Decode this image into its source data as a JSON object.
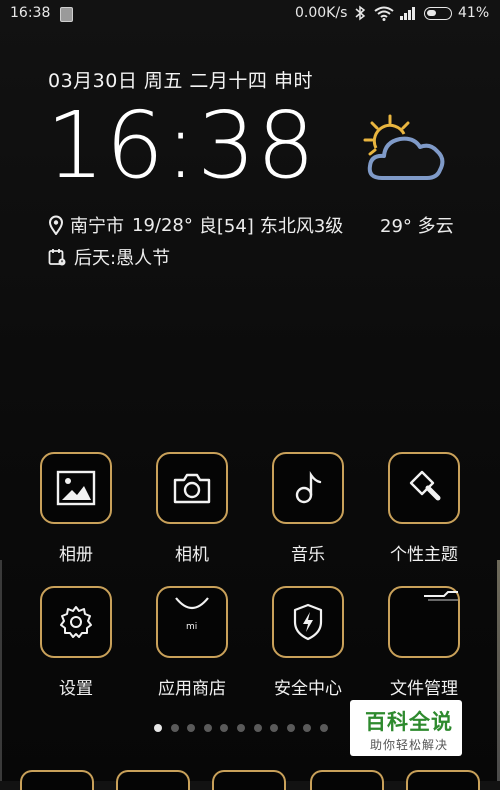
{
  "status_bar": {
    "time": "16:38",
    "net_speed": "0.00K/s",
    "battery_percent": "41%",
    "battery_level": 0.41,
    "icons": [
      "notification-icon",
      "bluetooth-icon",
      "wifi-icon",
      "signal-icon",
      "battery-icon"
    ]
  },
  "lockscreen": {
    "date": "03月30日  周五  二月十四  申时",
    "clock": "16:38",
    "location": {
      "city": "南宁市",
      "temp_range": "19/28°",
      "aqi": "良[54]",
      "wind": "东北风3级"
    },
    "current_weather": "29°  多云",
    "holiday": "后天:愚人节",
    "weather_icon": "partly-cloudy-icon"
  },
  "apps": [
    {
      "label": "相册",
      "icon": "gallery-icon"
    },
    {
      "label": "相机",
      "icon": "camera-icon"
    },
    {
      "label": "音乐",
      "icon": "music-icon"
    },
    {
      "label": "个性主题",
      "icon": "theme-brush-icon"
    },
    {
      "label": "设置",
      "icon": "settings-gear-icon"
    },
    {
      "label": "应用商店",
      "icon": "app-store-bag-icon"
    },
    {
      "label": "安全中心",
      "icon": "security-shield-icon"
    },
    {
      "label": "文件管理",
      "icon": "file-folder-icon"
    }
  ],
  "pager": {
    "total": 11,
    "active": 0
  },
  "watermark": {
    "main": "百科全说",
    "sub": "助你轻松解决"
  },
  "colors": {
    "accent_gold": "#c9a15a",
    "background": "#0b0b0b",
    "watermark_green": "#2e8a2e"
  }
}
